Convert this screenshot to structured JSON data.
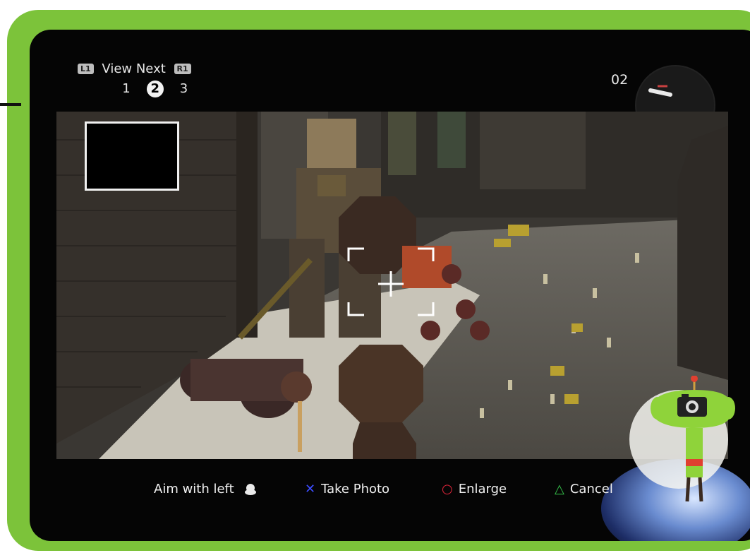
{
  "hud": {
    "l1_label": "L1",
    "view_next": "View Next",
    "r1_label": "R1",
    "pages": [
      "1",
      "2",
      "3"
    ],
    "active_page": "2",
    "counter": "02"
  },
  "prompts": {
    "aim": "Aim with left",
    "take_photo": "Take Photo",
    "enlarge": "Enlarge",
    "cancel": "Cancel",
    "cross_symbol": "✕",
    "circle_symbol": "○",
    "triangle_symbol": "△"
  },
  "colors": {
    "frame_green": "#7cc33a",
    "cross_blue": "#3b4cff",
    "circle_red": "#e0243a",
    "triangle_green": "#35c24a",
    "mascot_green": "#8fd33a"
  },
  "icons": {
    "camera": "camera-icon",
    "crosshair": "crosshair-icon",
    "stick": "analog-stick-icon"
  }
}
